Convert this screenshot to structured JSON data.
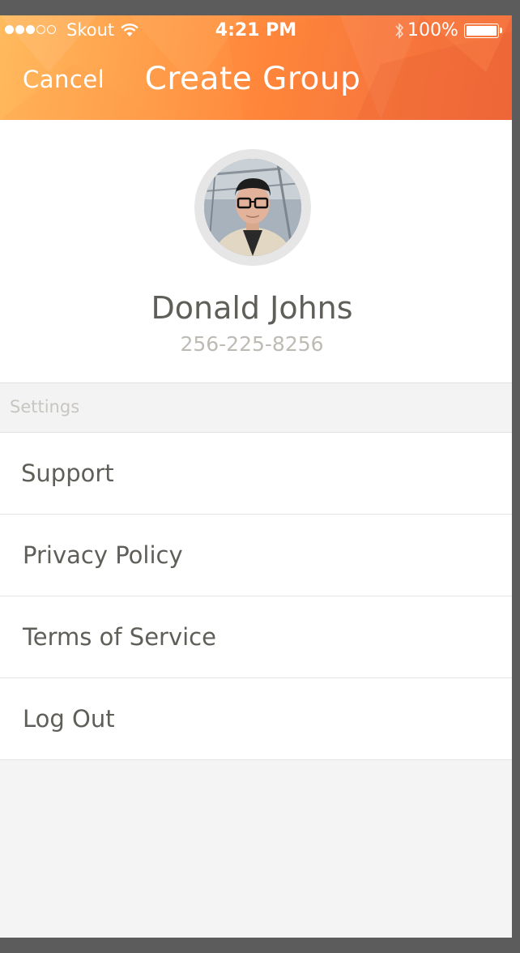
{
  "status_bar": {
    "carrier": "Skout",
    "time": "4:21 PM",
    "battery": "100%"
  },
  "nav": {
    "cancel_label": "Cancel",
    "title": "Create Group"
  },
  "profile": {
    "name": "Donald Johns",
    "phone": "256-225-8256"
  },
  "settings": {
    "header": "Settings",
    "items": [
      {
        "label": "Support"
      },
      {
        "label": "Privacy Policy"
      },
      {
        "label": "Terms of Service"
      },
      {
        "label": "Log Out"
      }
    ]
  },
  "colors": {
    "header_gradient_start": "#ffba5e",
    "header_gradient_end": "#f06a3a",
    "text_primary": "#5f5e58",
    "text_secondary": "#bdbbb3"
  }
}
